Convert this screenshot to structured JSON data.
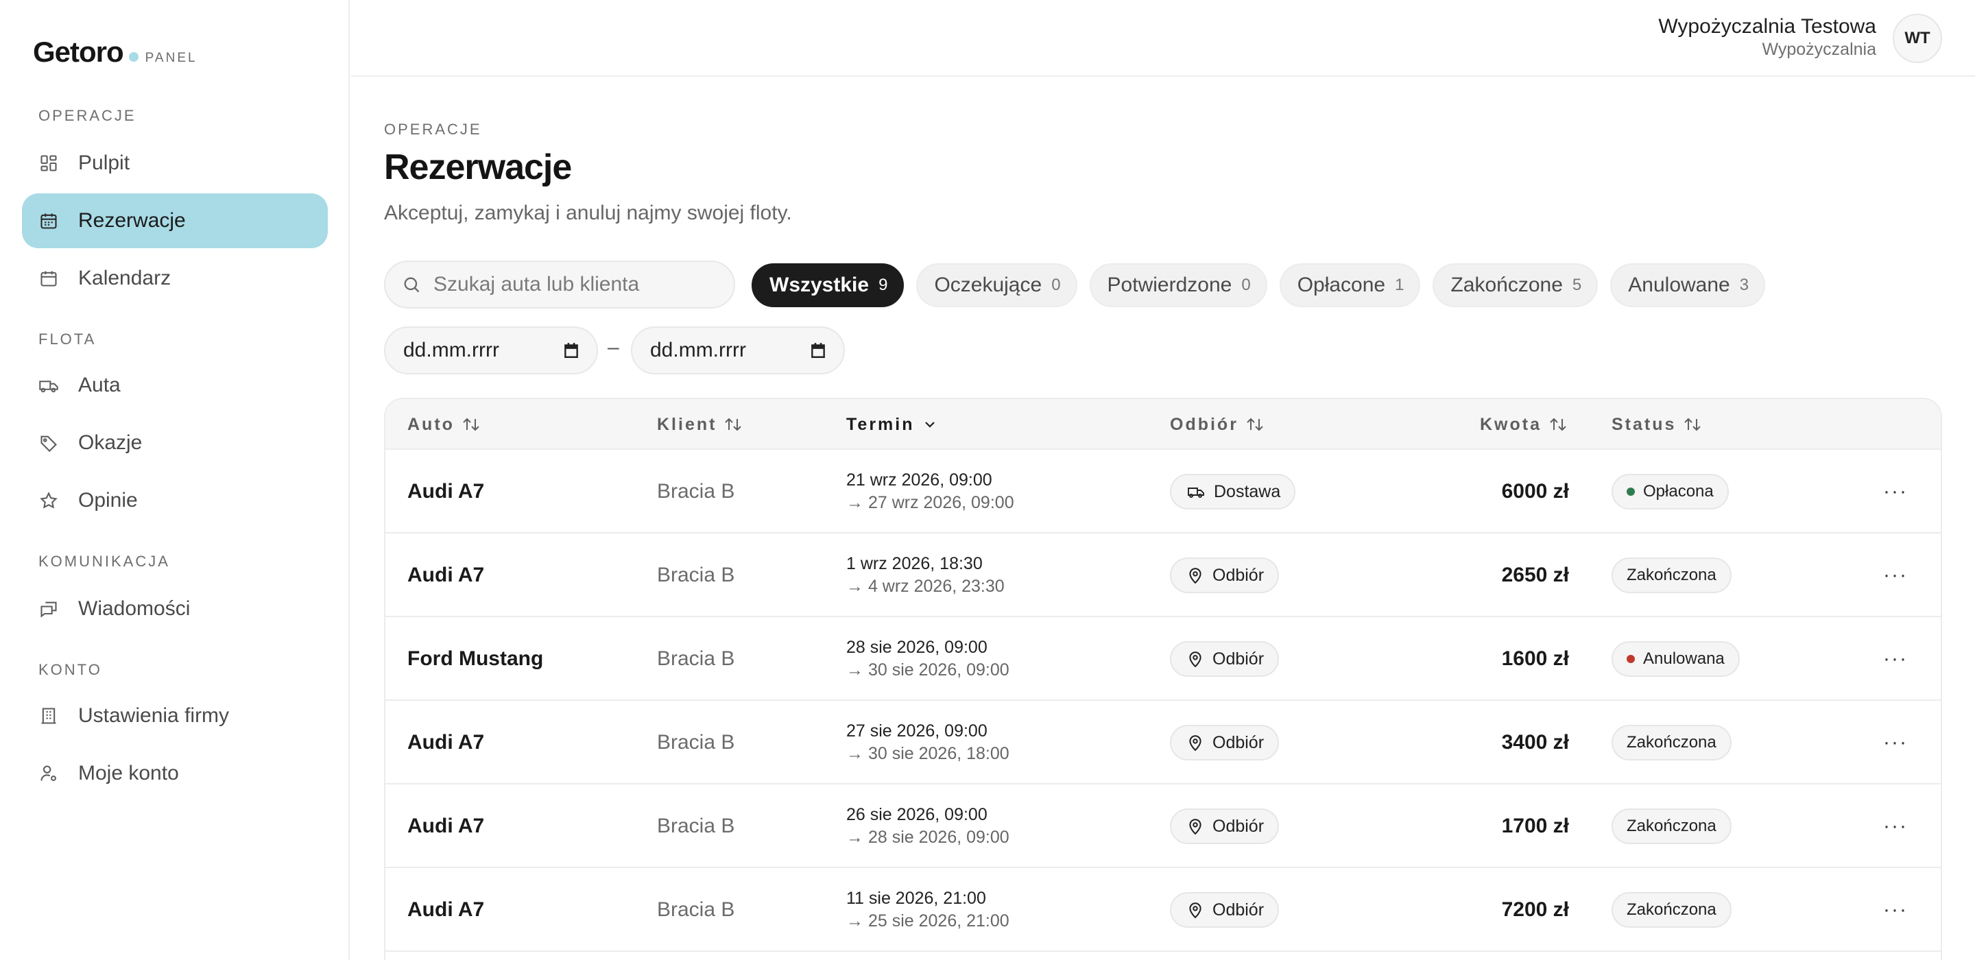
{
  "brand": {
    "name": "Getoro",
    "sub": "PANEL"
  },
  "sidebar": {
    "sections": [
      {
        "title": "OPERACJE",
        "items": [
          {
            "label": "Pulpit",
            "icon": "dashboard-icon"
          },
          {
            "label": "Rezerwacje",
            "icon": "calendar-icon",
            "active": true
          },
          {
            "label": "Kalendarz",
            "icon": "calendar-icon"
          }
        ]
      },
      {
        "title": "FLOTA",
        "items": [
          {
            "label": "Auta",
            "icon": "truck-icon"
          },
          {
            "label": "Okazje",
            "icon": "tag-icon"
          },
          {
            "label": "Opinie",
            "icon": "star-icon"
          }
        ]
      },
      {
        "title": "KOMUNIKACJA",
        "items": [
          {
            "label": "Wiadomości",
            "icon": "messages-icon"
          }
        ]
      },
      {
        "title": "KONTO",
        "items": [
          {
            "label": "Ustawienia firmy",
            "icon": "building-icon"
          },
          {
            "label": "Moje konto",
            "icon": "user-settings-icon"
          }
        ]
      }
    ]
  },
  "header": {
    "user_name": "Wypożyczalnia Testowa",
    "user_role": "Wypożyczalnia",
    "avatar_initials": "WT"
  },
  "page": {
    "eyebrow": "OPERACJE",
    "title": "Rezerwacje",
    "subtitle": "Akceptuj, zamykaj i anuluj najmy swojej floty."
  },
  "search": {
    "placeholder": "Szukaj auta lub klienta",
    "value": ""
  },
  "tabs": [
    {
      "label": "Wszystkie",
      "count": "9",
      "active": true
    },
    {
      "label": "Oczekujące",
      "count": "0"
    },
    {
      "label": "Potwierdzone",
      "count": "0"
    },
    {
      "label": "Opłacone",
      "count": "1"
    },
    {
      "label": "Zakończone",
      "count": "5"
    },
    {
      "label": "Anulowane",
      "count": "3"
    }
  ],
  "date_filter": {
    "from": "dd.mm.rrrr",
    "separator": "–",
    "to": "dd.mm.rrrr"
  },
  "table": {
    "columns": [
      {
        "label": "Auto",
        "sort_icon": "sort-icon"
      },
      {
        "label": "Klient",
        "sort_icon": "sort-icon"
      },
      {
        "label": "Termin",
        "sort_icon": "chevron-down-icon",
        "active": true
      },
      {
        "label": "Odbiór",
        "sort_icon": "sort-icon"
      },
      {
        "label": "Kwota",
        "sort_icon": "sort-icon"
      },
      {
        "label": "Status",
        "sort_icon": "sort-icon"
      }
    ],
    "rows": [
      {
        "car": "Audi A7",
        "client": "Bracia B",
        "start": "21 wrz 2026, 09:00",
        "end": "→ 27 wrz 2026, 09:00",
        "pickup": "Dostawa",
        "pickup_icon": "truck-icon",
        "amount": "6000 zł",
        "status": "Opłacona",
        "status_color": "#2e7d4f"
      },
      {
        "car": "Audi A7",
        "client": "Bracia B",
        "start": "1 wrz 2026, 18:30",
        "end": "→ 4 wrz 2026, 23:30",
        "pickup": "Odbiór",
        "pickup_icon": "location-pin-icon",
        "amount": "2650 zł",
        "status": "Zakończona",
        "status_color": ""
      },
      {
        "car": "Ford Mustang",
        "client": "Bracia B",
        "start": "28 sie 2026, 09:00",
        "end": "→ 30 sie 2026, 09:00",
        "pickup": "Odbiór",
        "pickup_icon": "location-pin-icon",
        "amount": "1600 zł",
        "status": "Anulowana",
        "status_color": "#c0392b"
      },
      {
        "car": "Audi A7",
        "client": "Bracia B",
        "start": "27 sie 2026, 09:00",
        "end": "→ 30 sie 2026, 18:00",
        "pickup": "Odbiór",
        "pickup_icon": "location-pin-icon",
        "amount": "3400 zł",
        "status": "Zakończona",
        "status_color": ""
      },
      {
        "car": "Audi A7",
        "client": "Bracia B",
        "start": "26 sie 2026, 09:00",
        "end": "→ 28 sie 2026, 09:00",
        "pickup": "Odbiór",
        "pickup_icon": "location-pin-icon",
        "amount": "1700 zł",
        "status": "Zakończona",
        "status_color": ""
      },
      {
        "car": "Audi A7",
        "client": "Bracia B",
        "start": "11 sie 2026, 21:00",
        "end": "→ 25 sie 2026, 21:00",
        "pickup": "Odbiór",
        "pickup_icon": "location-pin-icon",
        "amount": "7200 zł",
        "status": "Zakończona",
        "status_color": ""
      }
    ],
    "row_action": "···"
  },
  "colors": {
    "accent": "#a8dbe6",
    "dark": "#1c1c1c",
    "paid": "#2e7d4f",
    "cancelled": "#c0392b"
  }
}
